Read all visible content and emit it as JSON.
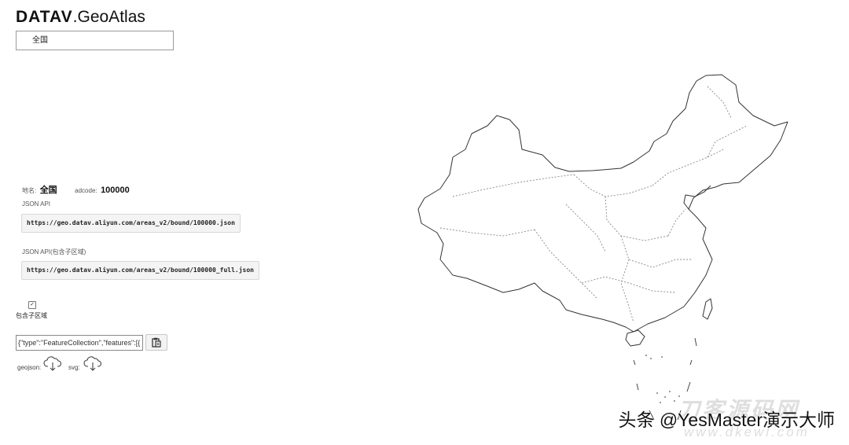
{
  "app": {
    "logo_bold": "DATAV",
    "logo_rest": ".GeoAtlas"
  },
  "region_select": {
    "selected": "全国"
  },
  "info": {
    "name_label": "地名:",
    "name_value": "全国",
    "adcode_label": "adcode:",
    "adcode_value": "100000"
  },
  "api": {
    "json_label": "JSON API",
    "json_url": "https://geo.datav.aliyun.com/areas_v2/bound/100000.json",
    "json_full_label": "JSON API(包含子区域)",
    "json_full_url": "https://geo.datav.aliyun.com/areas_v2/bound/100000_full.json"
  },
  "options": {
    "include_subregions_label": "包含子区域",
    "include_subregions_checked": true
  },
  "geojson_text": {
    "value": "{\"type\":\"FeatureCollection\",\"features\":[{"
  },
  "downloads": {
    "geojson_label": "geojson:",
    "svg_label": "svg:"
  },
  "icons": {
    "copy": "clipboard-icon",
    "download": "cloud-download-icon",
    "check": "checkmark-icon"
  },
  "watermark": {
    "text": "头条 @YesMaster演示大师",
    "site_cn": "刀客源码网",
    "site_url": "www.dkewl.com"
  }
}
